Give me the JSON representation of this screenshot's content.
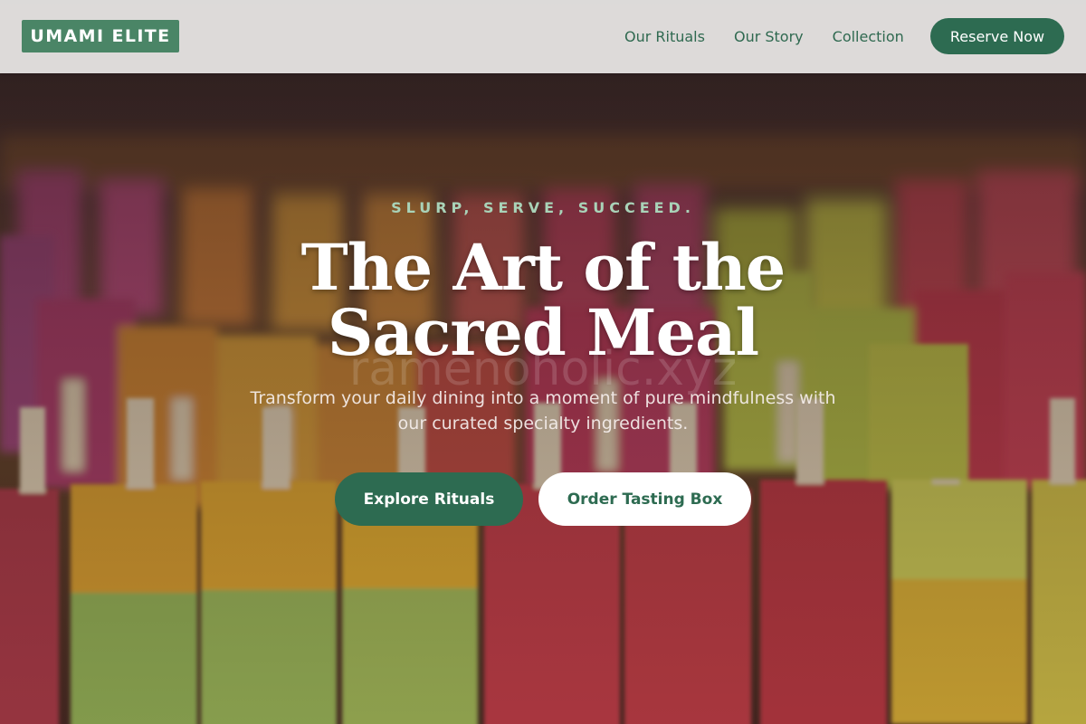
{
  "brand": {
    "name": "UMAMI ELITE"
  },
  "nav": {
    "items": [
      {
        "label": "Our Rituals"
      },
      {
        "label": "Our Story"
      },
      {
        "label": "Collection"
      }
    ],
    "cta_label": "Reserve Now"
  },
  "hero": {
    "tagline": "SLURP, SERVE, SUCCEED.",
    "title": "The Art of the Sacred Meal",
    "watermark": "ramenoholic.xyz",
    "subtitle": "Transform your daily dining into a moment of pure mindfulness with our curated specialty ingredients.",
    "primary_cta": "Explore Rituals",
    "secondary_cta": "Order Tasting Box",
    "background_image": "blurred-popsicle-display"
  },
  "colors": {
    "accent": "#2d6b51",
    "logo_bg": "#4a8566",
    "tagline": "#a9d3b8",
    "header_bg": "#ebe8e7"
  }
}
